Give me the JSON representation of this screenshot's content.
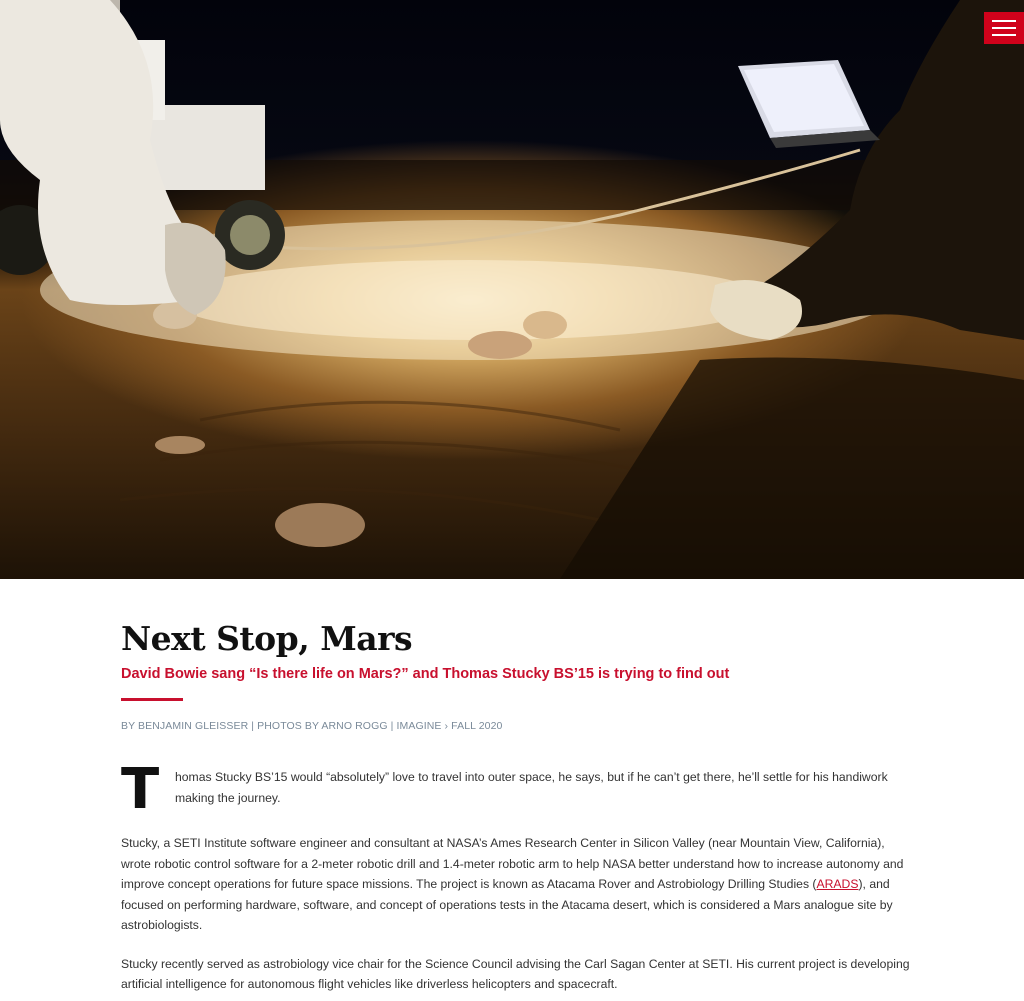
{
  "nav": {
    "menu_icon": "hamburger-menu-icon",
    "accent": "#d0021b"
  },
  "hero": {
    "alt": ""
  },
  "article": {
    "title": "Next Stop, Mars",
    "subtitle": "David Bowie sang “Is there life on Mars?” and Thomas Stucky BS’15 is trying to find out",
    "byline": {
      "author": "BY BENJAMIN GLEISSER",
      "sep1": " | ",
      "photos": "PHOTOS BY ARNO ROGG",
      "sep2": " | ",
      "section": "IMAGINE",
      "arrow": " › ",
      "issue": "FALL 2020"
    },
    "dropcap": "T",
    "lead": "homas Stucky BS’15 would “absolutely” love to travel into outer space, he says, but if he can’t get there, he’ll settle for his handiwork making the journey.",
    "p2_before": "Stucky, a SETI Institute software engineer and consultant at NASA’s Ames Research Center in Silicon Valley (near Mountain View, California), wrote robotic control software for a 2-meter robotic drill and 1.4-meter robotic arm to help NASA better understand how to increase autonomy and improve concept operations for future space missions. The project is known as Atacama Rover and Astrobiology Drilling Studies (",
    "p2_link": "ARADS",
    "p2_after": "), and focused on performing hardware, software, and concept of operations tests in the Atacama desert, which is considered a Mars analogue site by astrobiologists.",
    "p3": "Stucky recently served as astrobiology vice chair for the Science Council advising the Carl Sagan Center at SETI. His current project is developing artificial intelligence for autonomous flight vehicles like driverless helicopters and spacecraft."
  },
  "colors": {
    "accent": "#c8102e",
    "byline": "#7a8a99",
    "text": "#333333"
  }
}
